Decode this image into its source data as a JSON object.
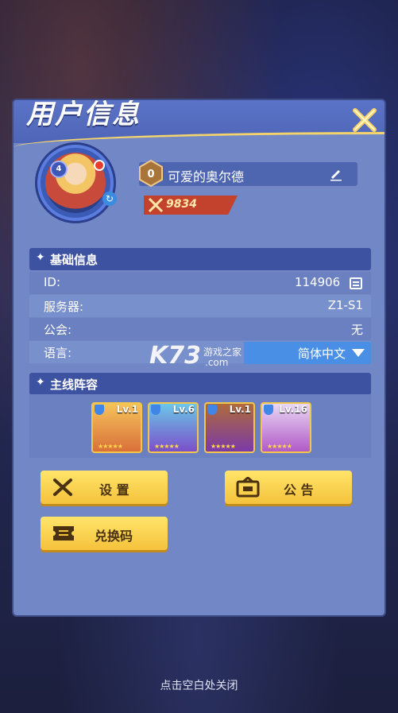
{
  "window": {
    "title": "用户信息"
  },
  "profile": {
    "avatar_level": "4",
    "name": "可爱的奥尔德",
    "power": "9834",
    "rank": "0"
  },
  "basic_info": {
    "title": "基础信息",
    "id_label": "ID:",
    "id_value": "114906",
    "server_label": "服务器:",
    "server_value": "Z1-S1",
    "guild_label": "公会:",
    "guild_value": "无",
    "language_label": "语言:",
    "language_value": "简体中文"
  },
  "lineup": {
    "title": "主线阵容",
    "heroes": [
      {
        "level": "Lv.1",
        "stars": "★★★★★"
      },
      {
        "level": "Lv.6",
        "stars": "★★★★★"
      },
      {
        "level": "Lv.1",
        "stars": "★★★★★"
      },
      {
        "level": "Lv.16",
        "stars": "★★★★★"
      }
    ]
  },
  "buttons": {
    "settings": "设 置",
    "notice": "公 告",
    "redeem": "兑换码"
  },
  "watermark": {
    "logo": "K73",
    "sub1": "游戏之家",
    "sub2": ".com"
  },
  "footer": "点击空白处关闭",
  "colors": {
    "panel": "#7288c6",
    "header": "#5b73c6",
    "button": "#f5c23c",
    "accent": "#f3d36b"
  }
}
